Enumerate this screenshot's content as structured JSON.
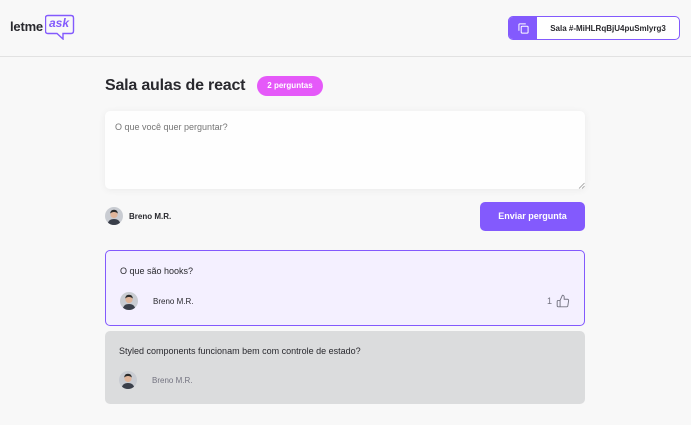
{
  "header": {
    "logo_text": "letme",
    "logo_accent": "ask",
    "room_code": "Sala #-MiHLRqBjU4puSmIyrg3",
    "copy_icon": "copy-icon"
  },
  "room": {
    "title": "Sala aulas de react",
    "question_count": "2 perguntas"
  },
  "form": {
    "placeholder": "O que você quer perguntar?",
    "user_name": "Breno M.R.",
    "submit_label": "Enviar pergunta"
  },
  "questions": [
    {
      "content": "O que são hooks?",
      "author": "Breno M.R.",
      "likes": "1",
      "state": "highlighted"
    },
    {
      "content": "Styled components funcionam bem com controle de estado?",
      "author": "Breno M.R.",
      "state": "answered"
    }
  ],
  "colors": {
    "brand": "#835afd",
    "badge": "#e559f9",
    "highlight_bg": "#f4f0ff",
    "answered_bg": "#dbdcdd"
  }
}
